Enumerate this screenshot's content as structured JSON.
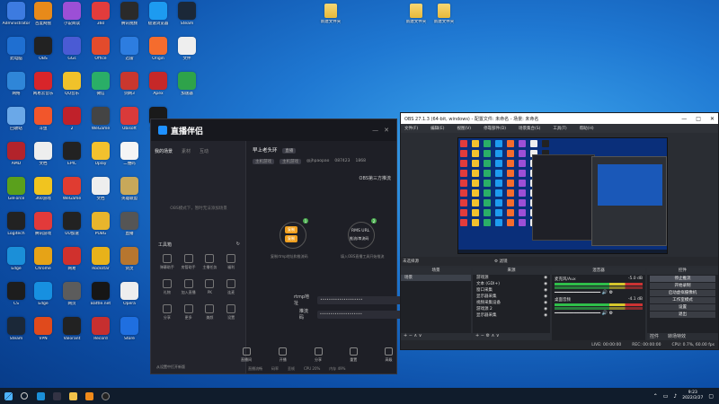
{
  "desktop": {
    "icons": [
      {
        "label": "Administrator",
        "color": "#3d7be0"
      },
      {
        "label": "百度网盘",
        "color": "#e88a1a"
      },
      {
        "label": "小说阅读",
        "color": "#9c4fd6"
      },
      {
        "label": "360",
        "color": "#e23c3c"
      },
      {
        "label": "腾讯视频",
        "color": "#2a2a2a"
      },
      {
        "label": "极速浏览器",
        "color": "#1d9bf0"
      },
      {
        "label": "Steam",
        "color": "#1b2838"
      },
      {
        "label": "此电脑",
        "color": "#1f6fd1"
      },
      {
        "label": "OBS",
        "color": "#222"
      },
      {
        "label": "GGs",
        "color": "#4a5bd4"
      },
      {
        "label": "Office",
        "color": "#e34b2c"
      },
      {
        "label": "迅雷",
        "color": "#2d7de0"
      },
      {
        "label": "Origin",
        "color": "#f56c2d"
      },
      {
        "label": "文件",
        "color": "#eeeeee"
      },
      {
        "label": "网络",
        "color": "#2f86d8"
      },
      {
        "label": "网易云音乐",
        "color": "#d8252a"
      },
      {
        "label": "QQ音乐",
        "color": "#f0c22a"
      },
      {
        "label": "微信",
        "color": "#2aae67"
      },
      {
        "label": "剑网3",
        "color": "#c9372e"
      },
      {
        "label": "Apex",
        "color": "#c62828"
      },
      {
        "label": "加速器",
        "color": "#2ea34a"
      },
      {
        "label": "回收站",
        "color": "#6aa8e8"
      },
      {
        "label": "斗鱼",
        "color": "#f2562b"
      },
      {
        "label": "2",
        "color": "#c0212a"
      },
      {
        "label": "WeGame",
        "color": "#444"
      },
      {
        "label": "Ubisoft",
        "color": "#d93a3a"
      },
      {
        "label": "直播伴侣",
        "color": "#1a1a1a"
      },
      {
        "label": "AMD",
        "color": "#b3232b"
      },
      {
        "label": "文档",
        "color": "#eeeeee"
      },
      {
        "label": "EPIC",
        "color": "#222"
      },
      {
        "label": "Uplay",
        "color": "#f2c12e"
      },
      {
        "label": "二维码",
        "color": "#f5f5f5"
      },
      {
        "label": "GeForce",
        "color": "#5aa01c"
      },
      {
        "label": "360游戏",
        "color": "#f1c41f"
      },
      {
        "label": "WeGame",
        "color": "#e03c31"
      },
      {
        "label": "文档",
        "color": "#eeeeee"
      },
      {
        "label": "英雄联盟",
        "color": "#c8a85a"
      },
      {
        "label": "Logitech",
        "color": "#222"
      },
      {
        "label": "腾讯游戏",
        "color": "#e23a3a"
      },
      {
        "label": "UU加速",
        "color": "#222"
      },
      {
        "label": "PUBG",
        "color": "#e8b52c"
      },
      {
        "label": "直播",
        "color": "#555"
      },
      {
        "label": "Edge",
        "color": "#1b8fd8"
      },
      {
        "label": "Chrome",
        "color": "#e6a317"
      },
      {
        "label": "网易",
        "color": "#d0312d"
      },
      {
        "label": "Rockstar",
        "color": "#e8b21a"
      },
      {
        "label": "剑灵",
        "color": "#b7762f"
      },
      {
        "label": "CS",
        "color": "#1d1d1d"
      },
      {
        "label": "Edge",
        "color": "#1790e0"
      },
      {
        "label": "网页",
        "color": "#5c5c5c"
      },
      {
        "label": "Battle.net",
        "color": "#161616"
      },
      {
        "label": "Opera",
        "color": "#eeeeee"
      },
      {
        "label": "Steam",
        "color": "#1b2838"
      },
      {
        "label": "VPN",
        "color": "#e04a1c"
      },
      {
        "label": "Valorant",
        "color": "#222"
      },
      {
        "label": "Record",
        "color": "#c62f2f"
      },
      {
        "label": "Store",
        "color": "#1f6fe0"
      }
    ],
    "folders": [
      {
        "label": "新建文件夹"
      },
      {
        "label": "新建文件夹"
      },
      {
        "label": "新建文件夹"
      }
    ]
  },
  "live": {
    "title": "直播伴侣",
    "tabs": [
      "我的场景",
      "素材",
      "互动"
    ],
    "empty_text": "OBS模式下，暂时无法添加场景",
    "tools_title": "工具箱",
    "tools": [
      {
        "label": "弹幕助手"
      },
      {
        "label": "房管助手"
      },
      {
        "label": "主播任务"
      },
      {
        "label": "福利"
      },
      {
        "label": "礼物"
      },
      {
        "label": "加入直播"
      },
      {
        "label": "PK"
      },
      {
        "label": "连麦"
      },
      {
        "label": "分享"
      },
      {
        "label": "更多"
      },
      {
        "label": "美颜"
      },
      {
        "label": "设置"
      }
    ],
    "footer_note": "从设置中打开新版",
    "room_title": "早上老头环",
    "room_badge": "直播",
    "meta_pills": [
      "主机游戏",
      "主机游戏"
    ],
    "meta_id": "@jhpaopao",
    "meta_stats": [
      "087423",
      "1868"
    ],
    "obs_label": "OBS第三方推流",
    "step1": "复制",
    "step1b": "复制",
    "step2_title": "RMS URL",
    "step2_sub": "推流/串流码",
    "cap1": "复制rtmp地址和推流码",
    "cap2": "填入OBS直播工具开始推流",
    "rtmp_label": "rtmp地址",
    "rtmp_value": "••••••••••••••••••••",
    "key_label": "推流码",
    "key_value": "••••••••••••••••••••",
    "bottom": [
      "直播间",
      "开播",
      "分享",
      "重置",
      "高级"
    ],
    "status": [
      "直播流畅",
      "码率",
      "丢帧",
      "CPU 20%",
      "内存 49%"
    ]
  },
  "obs": {
    "title": "OBS 27.1.3 (64-bit, windows) - 配置文件: 未命名 - 场景: 未命名",
    "menu": [
      "文件(F)",
      "编辑(E)",
      "视图(V)",
      "停靠部件(D)",
      "场景集合(S)",
      "工具(T)",
      "帮助(H)"
    ],
    "bar_label": "未选择源",
    "filters_label": "滤镜",
    "scenes_title": "场景",
    "scenes": [
      "场景"
    ],
    "sources_title": "来源",
    "sources": [
      "游戏源",
      "文本 (GDI+)",
      "窗口采集",
      "显示器采集",
      "视频采集设备",
      "游戏源 2",
      "显示器采集"
    ],
    "mixer_title": "混音器",
    "mixer": [
      {
        "name": "麦克风/Aux",
        "level": "-5.0 dB"
      },
      {
        "name": "桌面音频",
        "level": "-4.1 dB"
      }
    ],
    "transitions_title": "转场特效",
    "controls_title": "控件",
    "controls": [
      "停止推流",
      "开始录制",
      "启动虚拟摄像机",
      "工作室模式",
      "设置",
      "退出"
    ],
    "ctrl_tabs": [
      "控件",
      "转场特效"
    ],
    "status": [
      "LIVE: 00:00:00",
      "REC: 00:00:00",
      "CPU: 0.7%, 60.00 fps"
    ]
  },
  "taskbar": {
    "time": "9:23",
    "date": "2022/2/27"
  }
}
